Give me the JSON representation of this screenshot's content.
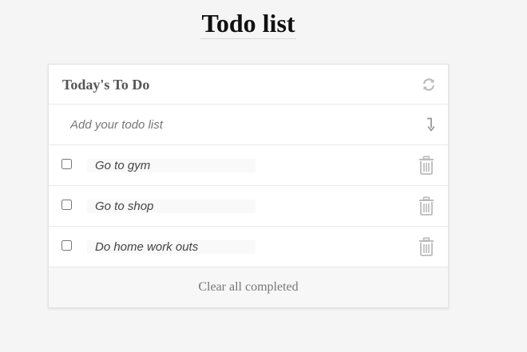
{
  "page": {
    "title": "Todo list"
  },
  "card": {
    "title": "Today's To Do",
    "refresh_icon": "refresh-icon",
    "add_input": {
      "placeholder": "Add your todo list",
      "value": ""
    },
    "add_icon": "down-arrow-icon",
    "items": [
      {
        "text": "Go to gym",
        "completed": false,
        "delete_icon": "trash-icon"
      },
      {
        "text": "Go to shop",
        "completed": false,
        "delete_icon": "trash-icon"
      },
      {
        "text": "Do home work outs",
        "completed": false,
        "delete_icon": "trash-icon"
      }
    ],
    "footer": {
      "clear_label": "Clear all completed"
    }
  },
  "colors": {
    "background": "#f5f5f5",
    "card": "#ffffff",
    "icon_gray": "#bbbbbb",
    "text": "#444444",
    "footer_bg": "#f7f7f7"
  }
}
